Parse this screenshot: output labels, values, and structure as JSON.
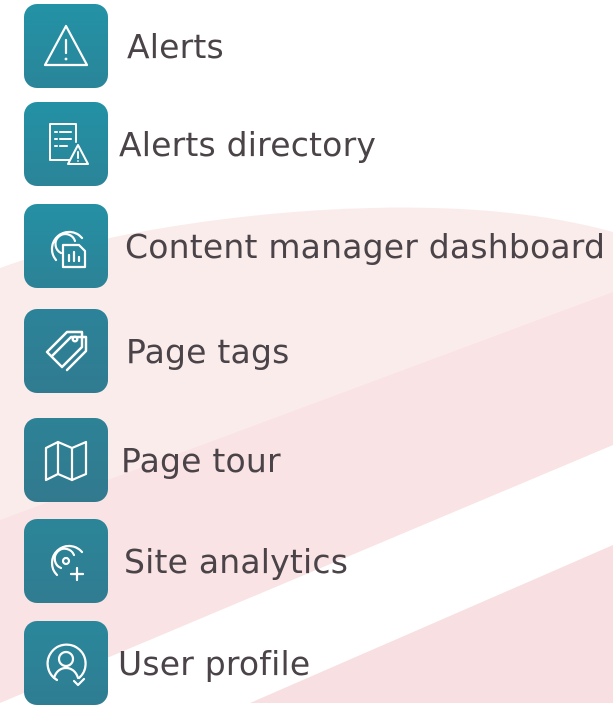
{
  "colors": {
    "tile_gradient_top": "#2390a3",
    "tile_gradient_bottom": "#2f7a90",
    "icon_stroke": "#ffffff",
    "label_text": "#4a4348",
    "background_blob": "#f9e3e4"
  },
  "menu": {
    "items": [
      {
        "label": "Alerts",
        "icon": "warning-triangle-icon"
      },
      {
        "label": "Alerts directory",
        "icon": "document-warning-icon"
      },
      {
        "label": "Content manager dashboard",
        "icon": "dashboard-document-icon"
      },
      {
        "label": "Page tags",
        "icon": "tag-icon"
      },
      {
        "label": "Page tour",
        "icon": "map-icon"
      },
      {
        "label": "Site analytics",
        "icon": "analytics-plus-icon"
      },
      {
        "label": "User profile",
        "icon": "user-profile-icon"
      }
    ]
  }
}
